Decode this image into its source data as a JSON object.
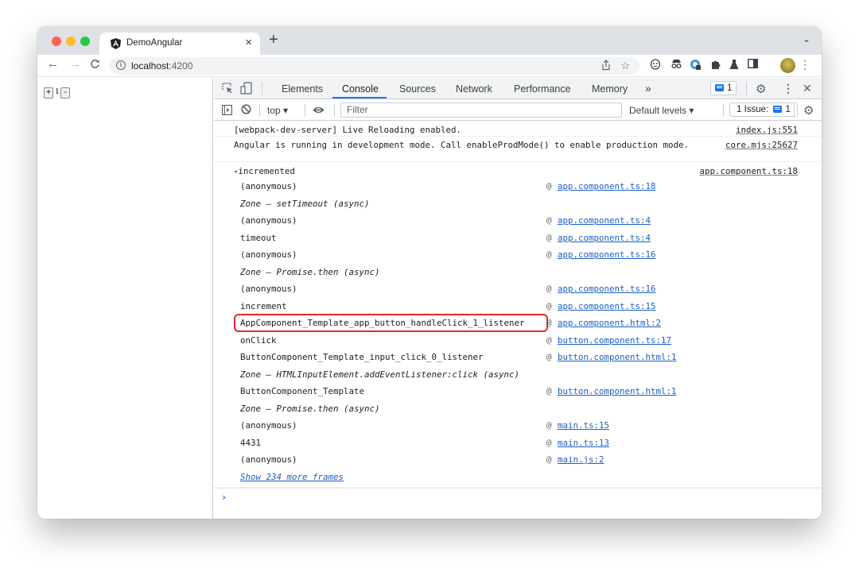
{
  "browser": {
    "tab": {
      "title": "DemoAngular",
      "favicon": "angular-logo-icon",
      "close": "×"
    },
    "new_tab": "+",
    "tab_search": "⌄",
    "nav": {
      "back": "←",
      "forward": "→",
      "reload": "C"
    },
    "address": {
      "host": "localhost",
      "port": ":4200",
      "info_icon": "i"
    },
    "toolbar_icons": [
      "share-icon",
      "bookmark-star-icon",
      "extension-mask-icon",
      "incognito-extension-icon",
      "password-extension-icon",
      "extensions-puzzle-icon",
      "labs-flask-icon",
      "side-panel-icon",
      "profile-avatar",
      "menu-kebab-icon"
    ]
  },
  "page": {
    "plus_label": "+",
    "count": "1",
    "minus_label": "-"
  },
  "devtools": {
    "tabs": [
      {
        "label": "Elements",
        "active": false
      },
      {
        "label": "Console",
        "active": true
      },
      {
        "label": "Sources",
        "active": false
      },
      {
        "label": "Network",
        "active": false
      },
      {
        "label": "Performance",
        "active": false
      },
      {
        "label": "Memory",
        "active": false
      }
    ],
    "more_tabs": "»",
    "messages_badge": "1",
    "close": "✕",
    "filterbar": {
      "context": "top ▾",
      "filter_placeholder": "Filter",
      "levels": "Default levels ▾",
      "issues_label": "1 Issue:",
      "issues_count": "1"
    },
    "console": {
      "messages": [
        {
          "text": "[webpack-dev-server] Live Reloading enabled.",
          "source": "index.js:551"
        },
        {
          "text": "Angular is running in development mode. Call enableProdMode() to enable production mode.",
          "source": "core.mjs:25627"
        }
      ],
      "group": {
        "label": "incremented",
        "toggle": "▾",
        "source": "app.component.ts:18",
        "frames": [
          {
            "name": "(anonymous)",
            "link": "app.component.ts:18",
            "async": false
          },
          {
            "name": "Zone – setTimeout (async)",
            "link": "",
            "async": true
          },
          {
            "name": "(anonymous)",
            "link": "app.component.ts:4",
            "async": false
          },
          {
            "name": "timeout",
            "link": "app.component.ts:4",
            "async": false
          },
          {
            "name": "(anonymous)",
            "link": "app.component.ts:16",
            "async": false
          },
          {
            "name": "Zone – Promise.then (async)",
            "link": "",
            "async": true
          },
          {
            "name": "(anonymous)",
            "link": "app.component.ts:16",
            "async": false
          },
          {
            "name": "increment",
            "link": "app.component.ts:15",
            "async": false
          },
          {
            "name": "AppComponent_Template_app_button_handleClick_1_listener",
            "link": "app.component.html:2",
            "async": false,
            "highlighted": true
          },
          {
            "name": "onClick",
            "link": "button.component.ts:17",
            "async": false
          },
          {
            "name": "ButtonComponent_Template_input_click_0_listener",
            "link": "button.component.html:1",
            "async": false
          },
          {
            "name": "Zone – HTMLInputElement.addEventListener:click (async)",
            "link": "",
            "async": true
          },
          {
            "name": "ButtonComponent_Template",
            "link": "button.component.html:1",
            "async": false
          },
          {
            "name": "Zone – Promise.then (async)",
            "link": "",
            "async": true
          },
          {
            "name": "(anonymous)",
            "link": "main.ts:15",
            "async": false
          },
          {
            "name": "4431",
            "link": "main.ts:13",
            "async": false
          },
          {
            "name": "(anonymous)",
            "link": "main.js:2",
            "async": false
          }
        ],
        "show_more": "Show 234 more frames"
      },
      "prompt": "›"
    }
  }
}
